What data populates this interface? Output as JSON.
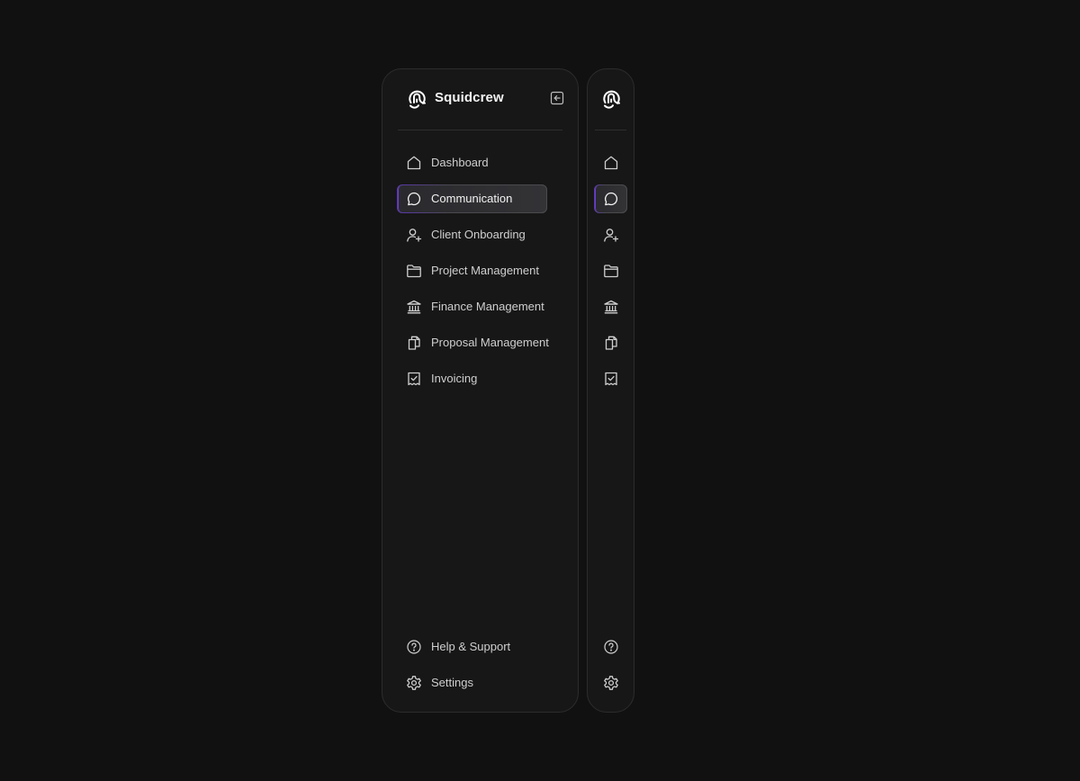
{
  "brand": {
    "name": "Squidcrew",
    "logo": "squid-logo",
    "collapse_icon": "collapse-sidebar-icon"
  },
  "nav": {
    "active": "communication",
    "items": [
      {
        "id": "dashboard",
        "label": "Dashboard",
        "icon": "home-icon"
      },
      {
        "id": "communication",
        "label": "Communication",
        "icon": "chat-bubble-icon"
      },
      {
        "id": "client-onboarding",
        "label": "Client Onboarding",
        "icon": "user-plus-icon"
      },
      {
        "id": "project-management",
        "label": "Project Management",
        "icon": "folder-icon"
      },
      {
        "id": "finance-management",
        "label": "Finance Management",
        "icon": "bank-icon"
      },
      {
        "id": "proposal-management",
        "label": "Proposal Management",
        "icon": "documents-icon"
      },
      {
        "id": "invoicing",
        "label": "Invoicing",
        "icon": "receipt-check-icon"
      }
    ]
  },
  "footer": {
    "items": [
      {
        "id": "help-support",
        "label": "Help & Support",
        "icon": "help-circle-icon"
      },
      {
        "id": "settings",
        "label": "Settings",
        "icon": "gear-icon"
      }
    ]
  },
  "colors": {
    "background": "#111111",
    "panel": "#171717",
    "accent": "#6b3fc9",
    "text": "#cfcfcf"
  }
}
